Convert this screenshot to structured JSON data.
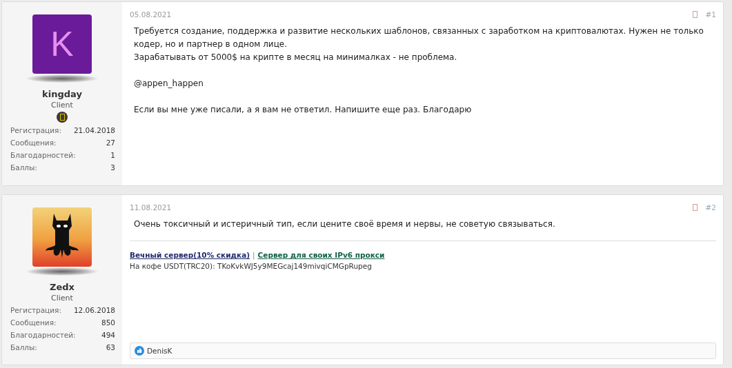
{
  "posts": [
    {
      "author": {
        "name": "kingday",
        "role": "Client",
        "avatar": {
          "kind": "letter",
          "letter": "K"
        },
        "badge": true
      },
      "stats": [
        {
          "label": "Регистрация:",
          "value": "21.04.2018"
        },
        {
          "label": "Сообщения:",
          "value": "27"
        },
        {
          "label": "Благодарностей:",
          "value": "1"
        },
        {
          "label": "Баллы:",
          "value": "3"
        }
      ],
      "date": "05.08.2021",
      "number": "#1",
      "body": [
        [
          "Требуется создание, поддержка и развитие нескольких шаблонов, связанных с заработком на криптовалютах. Нужен не только кодер, но и партнер в одном лице.",
          "Зарабатывать от 5000$ на крипте в месяц на минималках - не проблема."
        ],
        [
          "@appen_happen"
        ],
        [
          "Если вы мне уже писали, а я вам не ответил. Напишите еще раз. Благодарю"
        ]
      ]
    },
    {
      "author": {
        "name": "Zedx",
        "role": "Client",
        "avatar": {
          "kind": "picture"
        },
        "badge": false
      },
      "stats": [
        {
          "label": "Регистрация:",
          "value": "12.06.2018"
        },
        {
          "label": "Сообщения:",
          "value": "850"
        },
        {
          "label": "Благодарностей:",
          "value": "494"
        },
        {
          "label": "Баллы:",
          "value": "63"
        }
      ],
      "date": "11.08.2021",
      "number": "#2",
      "body": [
        [
          "Очень токсичный и истеричный тип, если цените своё время и нервы, не советую связываться."
        ]
      ],
      "signature": {
        "links": [
          {
            "text": "Вечный сервер(10% скидка)",
            "color": "#1f2d6b"
          },
          {
            "text": "Сервер для своих IPv6 прокси",
            "color": "#116149"
          }
        ],
        "separator": "|",
        "note": "На кофе USDT(TRC20): TKoKvkWJ5y9MEGcaj149mivqiCMGpRupeg"
      },
      "reactions": {
        "users": "DenisK"
      }
    }
  ]
}
